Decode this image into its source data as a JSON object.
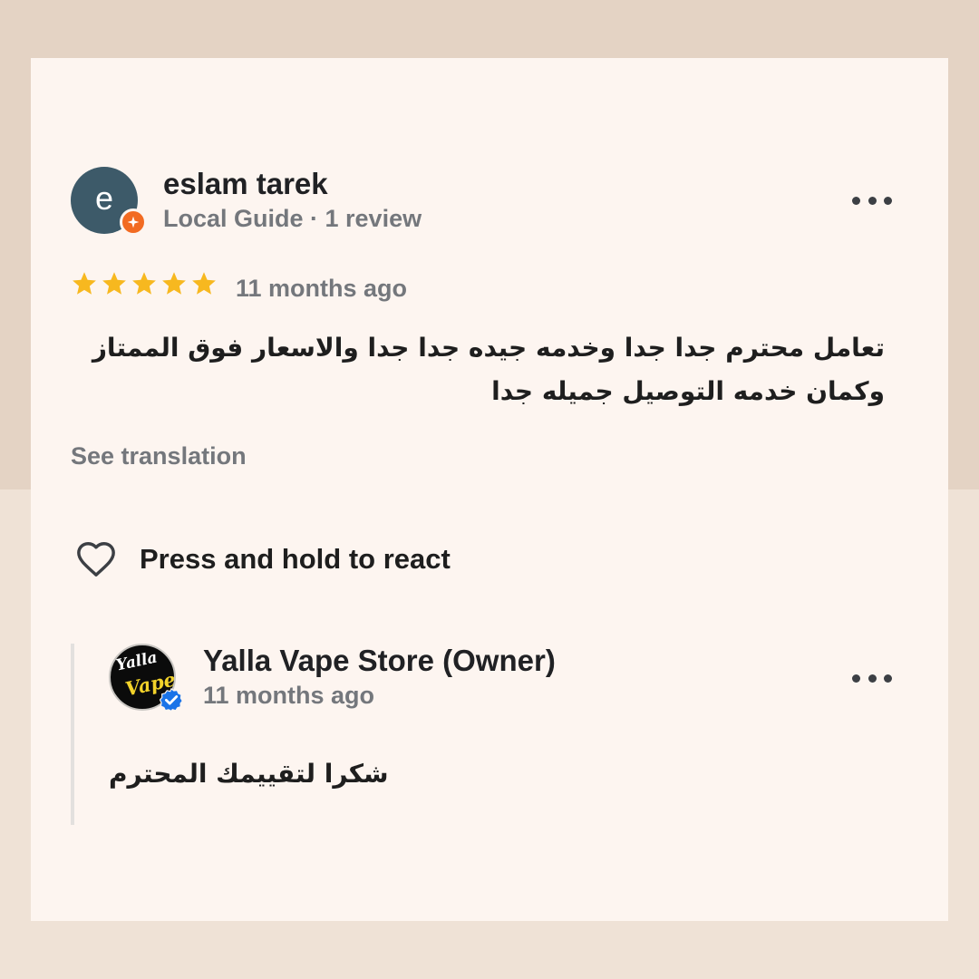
{
  "review": {
    "avatar_letter": "e",
    "avatar_color": "#3d5a69",
    "badge_icon": "local-guide-star-icon",
    "badge_color": "#f26b22",
    "reviewer_name": "eslam tarek",
    "reviewer_meta": "Local Guide · 1 review",
    "more_icon": "more-horiz-icon",
    "rating": 5,
    "rating_max": 5,
    "star_color": "#f7b81f",
    "time": "11 months ago",
    "text_lines": [
      "تعامل محترم جدا جدا وخدمه جيده جدا جدا  والاسعار فوق الممتاز",
      "وكمان خدمه التوصيل جميله جدا"
    ],
    "see_translation": "See translation",
    "react_icon": "heart-outline-icon",
    "react_label": "Press and hold to react"
  },
  "owner_reply": {
    "logo_text_1": "Yalla",
    "logo_text_2": "Vape",
    "verified_icon": "verified-check-icon",
    "verified_color": "#1a73e8",
    "name": "Yalla Vape Store (Owner)",
    "time": "11 months ago",
    "more_icon": "more-horiz-icon",
    "text": "شكرا لتقييمك المحترم"
  }
}
